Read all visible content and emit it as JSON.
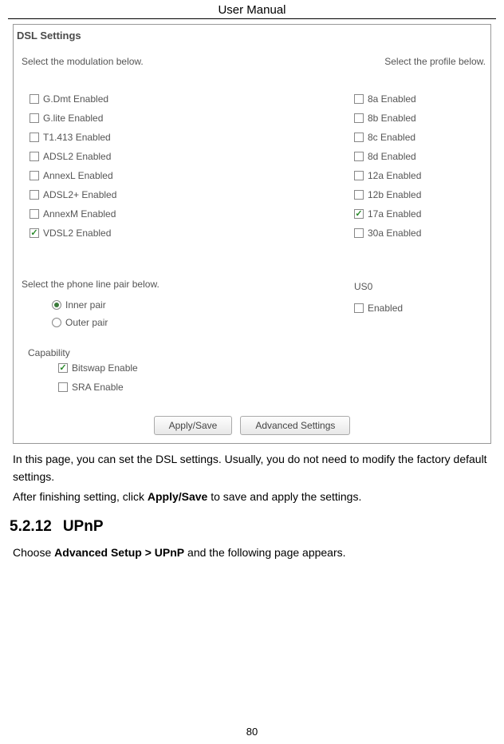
{
  "header": {
    "title": "User Manual"
  },
  "screenshot": {
    "dsl_title": "DSL Settings",
    "modulation_label": "Select the modulation below.",
    "profile_label": "Select the profile below.",
    "modulations": [
      {
        "label": "G.Dmt Enabled",
        "checked": false
      },
      {
        "label": "G.lite Enabled",
        "checked": false
      },
      {
        "label": "T1.413 Enabled",
        "checked": false
      },
      {
        "label": "ADSL2 Enabled",
        "checked": false
      },
      {
        "label": "AnnexL Enabled",
        "checked": false
      },
      {
        "label": "ADSL2+ Enabled",
        "checked": false
      },
      {
        "label": "AnnexM Enabled",
        "checked": false
      },
      {
        "label": "VDSL2 Enabled",
        "checked": true
      }
    ],
    "profiles": [
      {
        "label": "8a Enabled",
        "checked": false
      },
      {
        "label": "8b Enabled",
        "checked": false
      },
      {
        "label": "8c Enabled",
        "checked": false
      },
      {
        "label": "8d Enabled",
        "checked": false
      },
      {
        "label": "12a Enabled",
        "checked": false
      },
      {
        "label": "12b Enabled",
        "checked": false
      },
      {
        "label": "17a Enabled",
        "checked": true
      },
      {
        "label": "30a Enabled",
        "checked": false
      }
    ],
    "us0": {
      "heading": "US0",
      "label": "Enabled",
      "checked": false
    },
    "phone_label": "Select the phone line pair below.",
    "phone_options": [
      {
        "label": "Inner pair",
        "selected": true
      },
      {
        "label": "Outer pair",
        "selected": false
      }
    ],
    "capability": {
      "heading": "Capability",
      "options": [
        {
          "label": "Bitswap Enable",
          "checked": true
        },
        {
          "label": "SRA Enable",
          "checked": false
        }
      ]
    },
    "buttons": {
      "apply": "Apply/Save",
      "advanced": "Advanced Settings"
    }
  },
  "body": {
    "p1a": "In this page, you can set the DSL settings. Usually, you do not need to modify the factory default settings.",
    "p2a": "After finishing setting, click ",
    "p2b": "Apply/Save",
    "p2c": " to save and apply the settings."
  },
  "section": {
    "number": "5.2.12",
    "title": "UPnP",
    "p1a": "Choose ",
    "p1b": "Advanced Setup > UPnP",
    "p1c": " and the following page appears."
  },
  "page_number": "80"
}
